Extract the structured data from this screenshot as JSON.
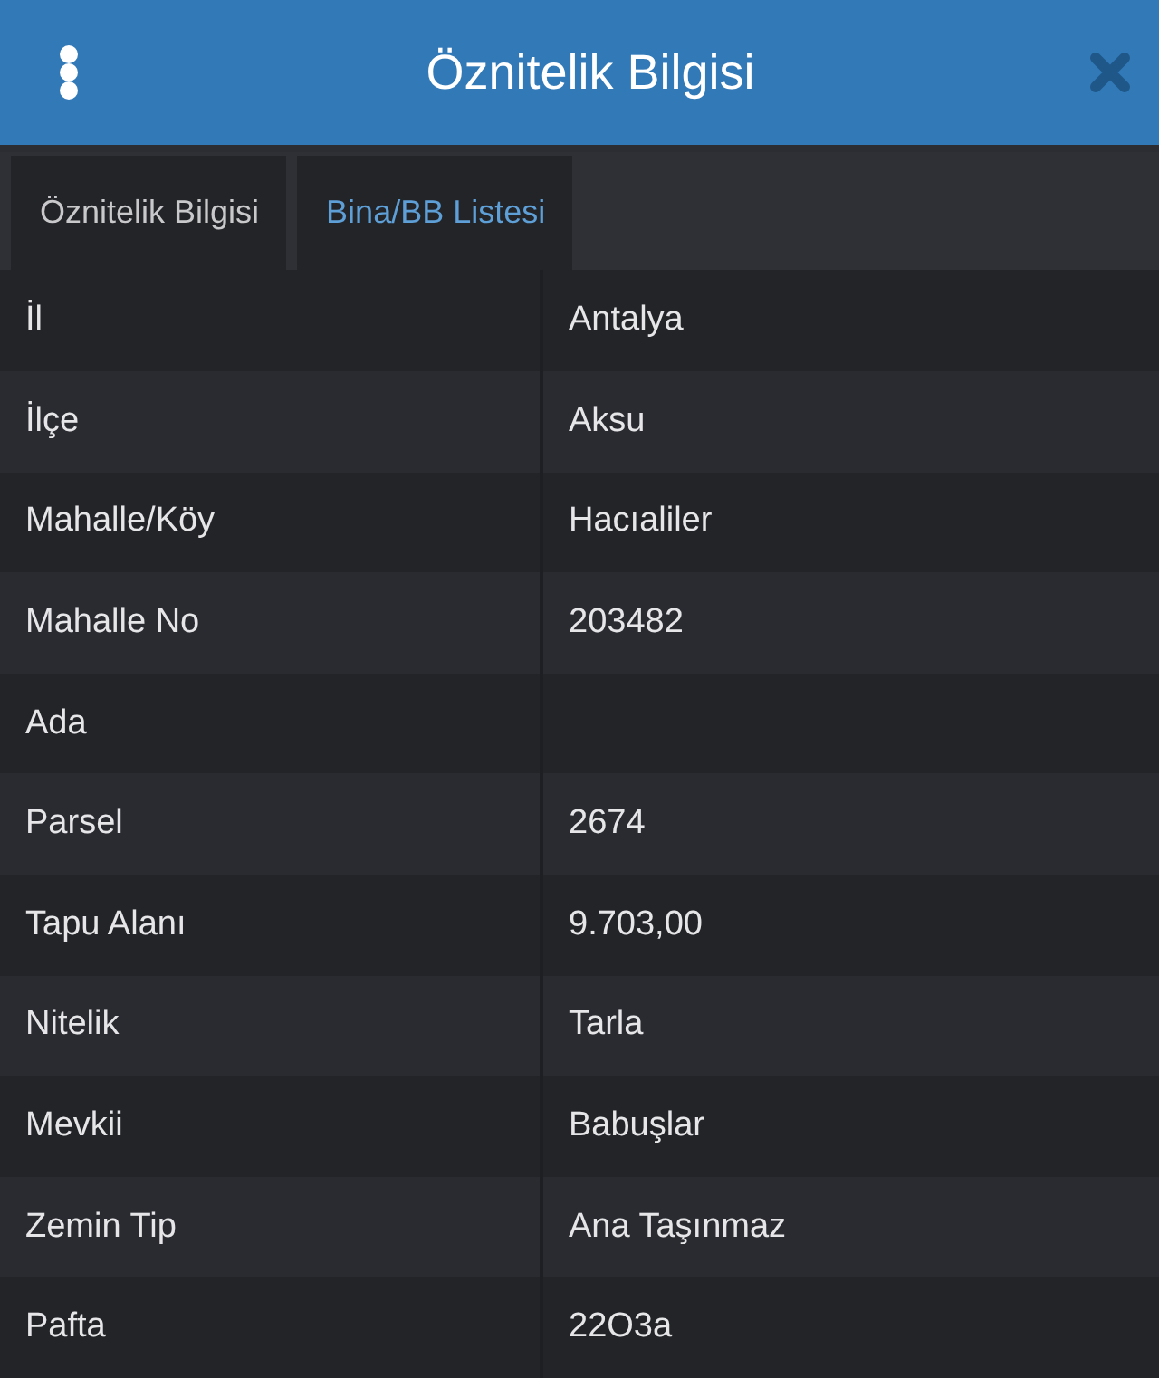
{
  "header": {
    "title": "Öznitelik Bilgisi"
  },
  "tabs": [
    {
      "label": "Öznitelik Bilgisi",
      "selected": true
    },
    {
      "label": "Bina/BB Listesi",
      "selected": false
    }
  ],
  "attributes": [
    {
      "label": "İl",
      "value": "Antalya"
    },
    {
      "label": "İlçe",
      "value": "Aksu"
    },
    {
      "label": "Mahalle/Köy",
      "value": "Hacıaliler"
    },
    {
      "label": "Mahalle No",
      "value": "203482"
    },
    {
      "label": "Ada"
    },
    {
      "label": "Parsel",
      "value": "2674"
    },
    {
      "label": "Tapu Alanı",
      "value": "9.703,00"
    },
    {
      "label": "Nitelik",
      "value": "Tarla"
    },
    {
      "label": "Mevkii",
      "value": "Babuşlar"
    },
    {
      "label": "Zemin Tip",
      "value": "Ana Taşınmaz"
    },
    {
      "label": "Pafta",
      "value": "22O3a"
    }
  ]
}
